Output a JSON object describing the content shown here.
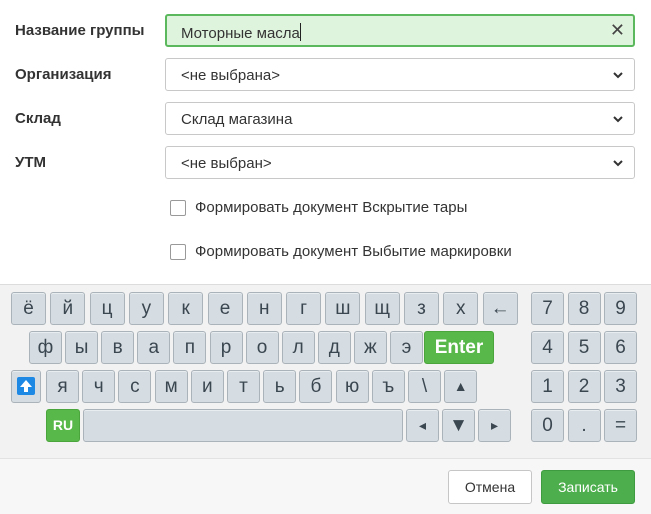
{
  "form": {
    "group_name": {
      "label": "Название группы",
      "value": "Моторные масла",
      "clear_icon": "✕"
    },
    "organization": {
      "label": "Организация",
      "value": "<не выбрана>"
    },
    "warehouse": {
      "label": "Склад",
      "value": "Склад магазина"
    },
    "utm": {
      "label": "УТМ",
      "value": "<не выбран>"
    },
    "checkbox_open_container": {
      "label": "Формировать документ Вскрытие тары",
      "checked": false
    },
    "checkbox_write_off": {
      "label": "Формировать документ Выбытие маркировки",
      "checked": false
    }
  },
  "keyboard": {
    "row1": [
      "ё",
      "й",
      "ц",
      "у",
      "к",
      "е",
      "н",
      "г",
      "ш",
      "щ",
      "з",
      "х",
      "←"
    ],
    "row2": [
      "ф",
      "ы",
      "в",
      "а",
      "п",
      "р",
      "о",
      "л",
      "д",
      "ж",
      "э"
    ],
    "enter": "Enter",
    "row3": [
      "я",
      "ч",
      "с",
      "м",
      "и",
      "т",
      "ь",
      "б",
      "ю",
      "ъ",
      "\\",
      "▲"
    ],
    "shift_icon": "🡅",
    "lang": "RU",
    "space": "",
    "arrows": [
      "◂",
      "▼",
      "▸"
    ],
    "numpad": [
      "7",
      "8",
      "9",
      "4",
      "5",
      "6",
      "1",
      "2",
      "3",
      "0",
      ".",
      "="
    ]
  },
  "footer": {
    "cancel": "Отмена",
    "save": "Записать"
  },
  "colors": {
    "accent_green": "#4cae4c",
    "active_field_bg": "#dff4dc",
    "key_bg": "#d6dde2"
  }
}
